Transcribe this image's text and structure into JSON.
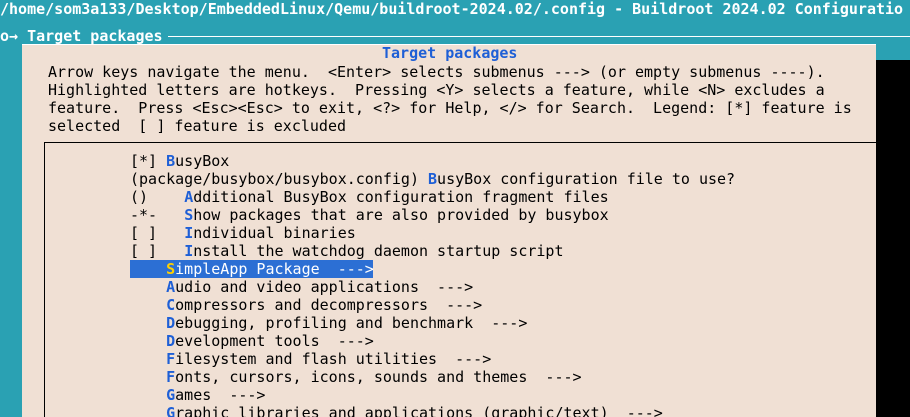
{
  "window": {
    "title": "/home/som3a133/Desktop/EmbeddedLinux/Qemu/buildroot-2024.02/.config - Buildroot 2024.02 Configuratio",
    "breadcrumb": "o→ Target packages"
  },
  "dialog": {
    "title": "Target packages",
    "help_lines": [
      "Arrow keys navigate the menu.  <Enter> selects submenus ---> (or empty submenus ----).",
      "Highlighted letters are hotkeys.  Pressing <Y> selects a feature, while <N> excludes a",
      "feature.  Press <Esc><Esc> to exit, <?> for Help, </> for Search.  Legend: [*] feature is",
      "selected  [ ] feature is excluded"
    ]
  },
  "menu": {
    "items": [
      {
        "prefix": "[*] ",
        "hotkey": "B",
        "rest": "usyBox"
      },
      {
        "prefix": "(package/busybox/busybox.config) ",
        "hotkey": "B",
        "rest": "usyBox configuration file to use?"
      },
      {
        "prefix": "()    ",
        "hotkey": "A",
        "rest": "dditional BusyBox configuration fragment files"
      },
      {
        "prefix": "-*-   ",
        "hotkey": "S",
        "rest": "how packages that are also provided by busybox"
      },
      {
        "prefix": "[ ]   ",
        "hotkey": "I",
        "rest": "ndividual binaries"
      },
      {
        "prefix": "[ ]   ",
        "hotkey": "I",
        "rest": "nstall the watchdog daemon startup script"
      },
      {
        "prefix": "    ",
        "hotkey": "S",
        "rest": "impleApp Package  --->"
      },
      {
        "prefix": "    ",
        "hotkey": "A",
        "rest": "udio and video applications  --->"
      },
      {
        "prefix": "    ",
        "hotkey": "C",
        "rest": "ompressors and decompressors  --->"
      },
      {
        "prefix": "    ",
        "hotkey": "D",
        "rest": "ebugging, profiling and benchmark  --->"
      },
      {
        "prefix": "    ",
        "hotkey": "D",
        "rest": "evelopment tools  --->"
      },
      {
        "prefix": "    ",
        "hotkey": "F",
        "rest": "ilesystem and flash utilities  --->"
      },
      {
        "prefix": "    ",
        "hotkey": "F",
        "rest": "onts, cursors, icons, sounds and themes  --->"
      },
      {
        "prefix": "    ",
        "hotkey": "G",
        "rest": "ames  --->"
      },
      {
        "prefix": "    ",
        "hotkey": "G",
        "rest": "raphic libraries and applications (graphic/text)  --->"
      }
    ]
  },
  "colors": {
    "background": "#2aa1b3",
    "dialog": "#f0e0d4",
    "hotkey": "#1e5fd6",
    "selection": "#2c6fd4"
  }
}
